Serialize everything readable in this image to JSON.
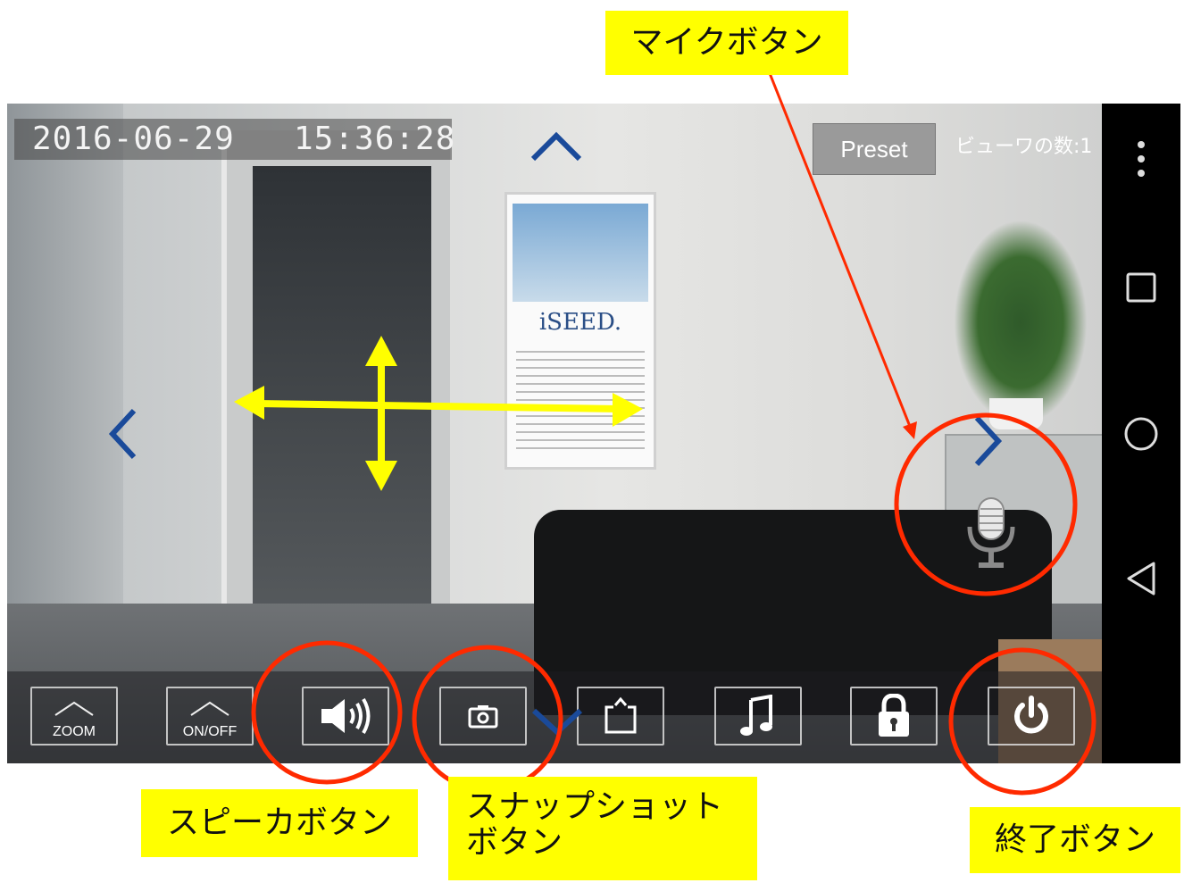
{
  "video": {
    "timestamp_date": "2016-06-29",
    "timestamp_time": "15:36:28",
    "preset_label": "Preset",
    "viewer_count": "ビューワの数:1",
    "poster_brand": "iSEED."
  },
  "toolbar": {
    "zoom_label": "ZOOM",
    "onoff_label": "ON/OFF",
    "buttons": [
      "zoom",
      "on-off",
      "speaker",
      "snapshot",
      "share",
      "music",
      "lock",
      "power"
    ]
  },
  "annotations": {
    "mic_button": "マイクボタン",
    "speaker_button": "スピーカボタン",
    "snapshot_button_line1": "スナップショット",
    "snapshot_button_line2": "ボタン",
    "end_button": "終了ボタン"
  },
  "colors": {
    "annotation_bg": "#ffff00",
    "circle_red": "#ff2a00",
    "pan_arrows": "#ffff00",
    "ptz_chevron": "#1a4a9a"
  },
  "icons": [
    "more-vert-icon",
    "recent-apps-icon",
    "home-icon",
    "back-icon",
    "microphone-icon",
    "speaker-icon",
    "camera-icon",
    "share-icon",
    "music-note-icon",
    "lock-icon",
    "power-icon"
  ]
}
